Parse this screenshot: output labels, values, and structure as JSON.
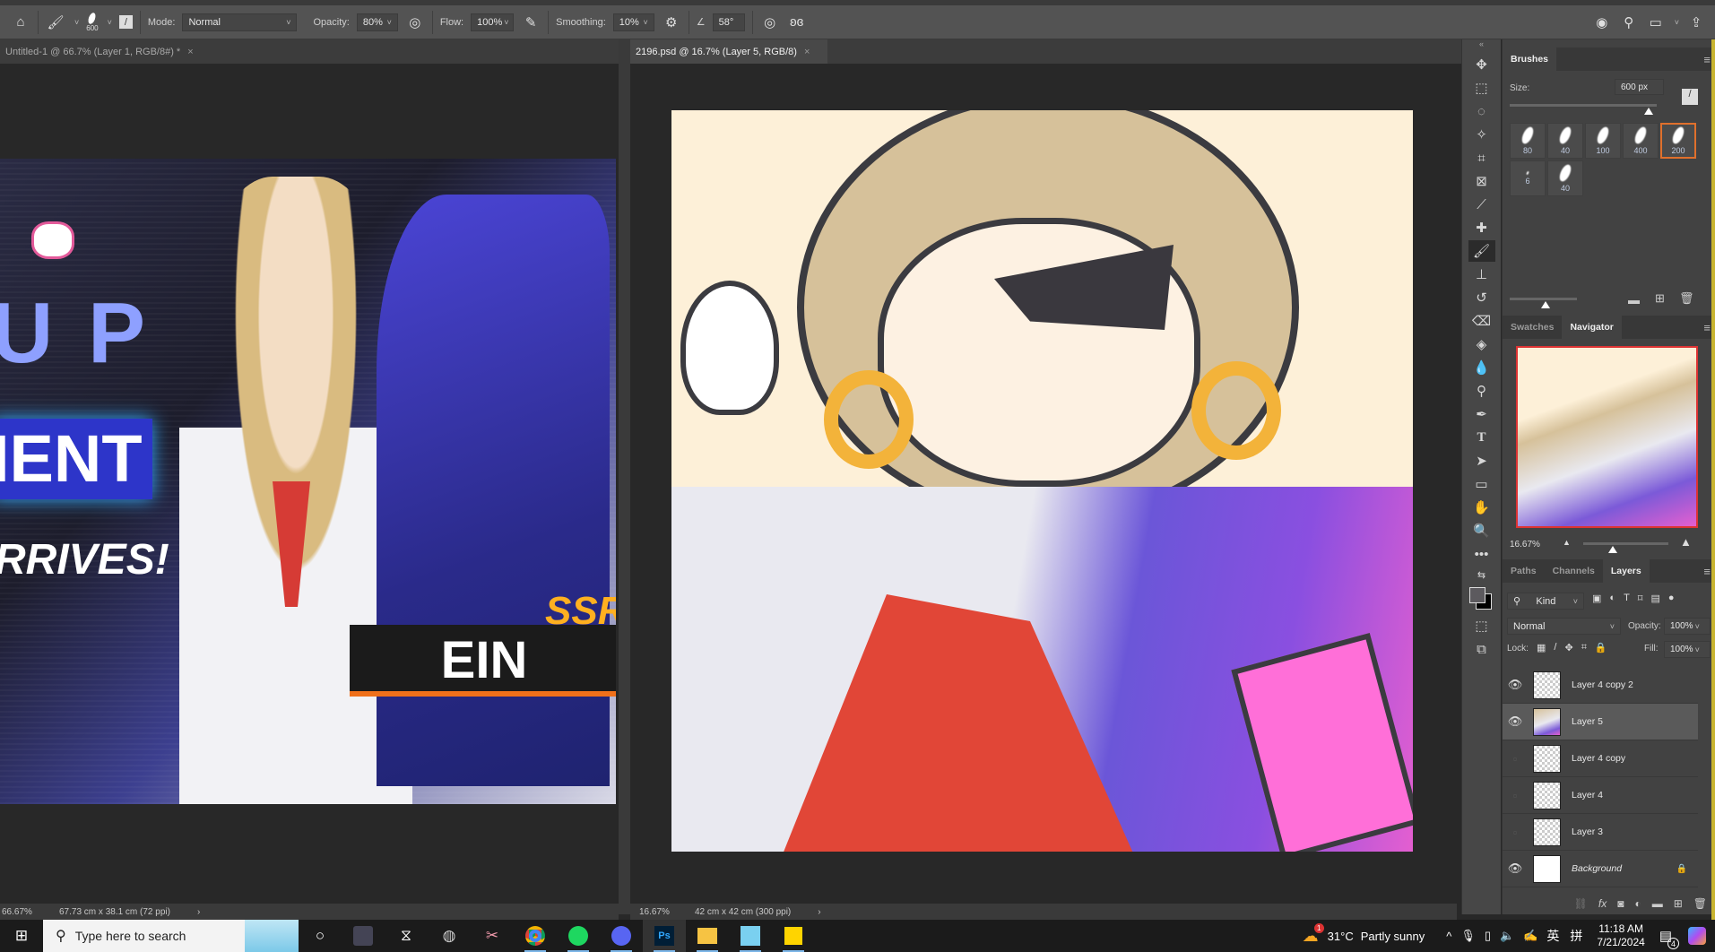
{
  "options_bar": {
    "brush_size": "600",
    "mode_label": "Mode:",
    "mode_value": "Normal",
    "opacity_label": "Opacity:",
    "opacity_value": "80%",
    "flow_label": "Flow:",
    "flow_value": "100%",
    "smoothing_label": "Smoothing:",
    "smoothing_value": "10%",
    "angle_value": "58°"
  },
  "documents": [
    {
      "title": "Untitled-1 @ 66.7% (Layer 1, RGB/8#) *",
      "zoom": "66.67%",
      "size": "67.73 cm x 38.1 cm (72 ppi)",
      "artwork_text": [
        "U P",
        "IENT",
        "RRIVES!",
        "EIN",
        "SSR"
      ]
    },
    {
      "title": "2196.psd @ 16.7% (Layer 5, RGB/8)",
      "zoom": "16.67%",
      "size": "42 cm x 42 cm (300 ppi)"
    }
  ],
  "brushes_panel": {
    "title": "Brushes",
    "size_label": "Size:",
    "size_value": "600 px",
    "brush_sizes": [
      "80",
      "40",
      "100",
      "400",
      "200",
      "6",
      "40"
    ],
    "selected_index": 4
  },
  "navigator": {
    "tabs": [
      "Swatches",
      "Navigator"
    ],
    "active_tab": "Navigator",
    "zoom": "16.67%"
  },
  "layers_panel": {
    "tabs": [
      "Paths",
      "Channels",
      "Layers"
    ],
    "active_tab": "Layers",
    "filter_kind": "Kind",
    "blend_mode": "Normal",
    "opacity_label": "Opacity:",
    "opacity_value": "100%",
    "lock_label": "Lock:",
    "fill_label": "Fill:",
    "fill_value": "100%",
    "layers": [
      {
        "name": "Layer 4 copy 2",
        "visible": true,
        "selected": false
      },
      {
        "name": "Layer 5",
        "visible": true,
        "selected": true
      },
      {
        "name": "Layer 4 copy",
        "visible": false,
        "selected": false
      },
      {
        "name": "Layer 4",
        "visible": false,
        "selected": false
      },
      {
        "name": "Layer 3",
        "visible": false,
        "selected": false
      },
      {
        "name": "Background",
        "visible": true,
        "selected": false,
        "locked": true
      }
    ]
  },
  "taskbar": {
    "search_placeholder": "Type here to search",
    "weather_temp": "31°C",
    "weather_desc": "Partly sunny",
    "weather_badge": "1",
    "ime_1": "英",
    "ime_2": "拼",
    "time": "11:18 AM",
    "date": "7/21/2024",
    "notification_count": "4",
    "ps_label": "Ps"
  },
  "colors": {
    "accent": "#e0702c",
    "panel_bg": "#424242",
    "canvas_bg": "#282828"
  }
}
